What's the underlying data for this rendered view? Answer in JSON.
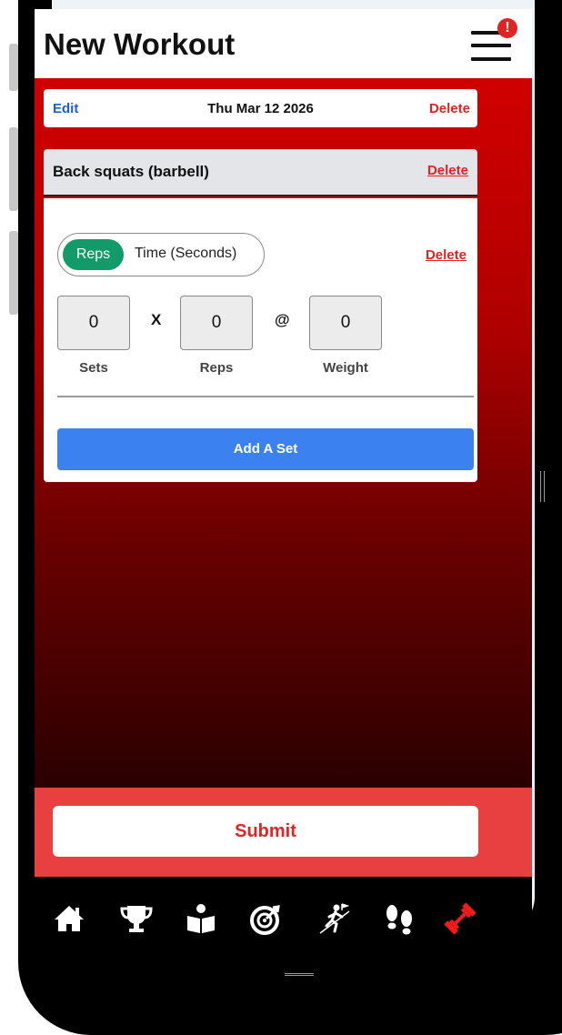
{
  "header": {
    "title": "New Workout",
    "menu_icon": "hamburger-menu-icon",
    "alert_badge": "!"
  },
  "date_bar": {
    "edit_label": "Edit",
    "date": "Thu Mar 12 2026",
    "delete_label": "Delete"
  },
  "exercise": {
    "name": "Back squats (barbell)",
    "delete_label": "Delete",
    "set": {
      "toggle_options": [
        "Reps",
        "Time (Seconds)"
      ],
      "selected": "Reps",
      "delete_label": "Delete",
      "sets": {
        "value": "0",
        "label": "Sets"
      },
      "separator_x": "X",
      "reps": {
        "value": "0",
        "label": "Reps"
      },
      "separator_at": "@",
      "weight": {
        "value": "0",
        "label": "Weight"
      }
    },
    "add_set_label": "Add A Set"
  },
  "submit_label": "Submit",
  "bottom_nav": [
    {
      "icon": "home-icon",
      "active": false
    },
    {
      "icon": "trophy-icon",
      "active": false
    },
    {
      "icon": "reading-person-icon",
      "active": false
    },
    {
      "icon": "target-icon",
      "active": false
    },
    {
      "icon": "climbing-person-icon",
      "active": false
    },
    {
      "icon": "footprints-icon",
      "active": false
    },
    {
      "icon": "dumbbell-icon",
      "active": true
    }
  ],
  "colors": {
    "accent_red": "#e02424",
    "link_blue": "#1d5fd6",
    "reps_green": "#129a6a",
    "button_blue": "#3b82f0",
    "submit_zone": "#e84040"
  }
}
